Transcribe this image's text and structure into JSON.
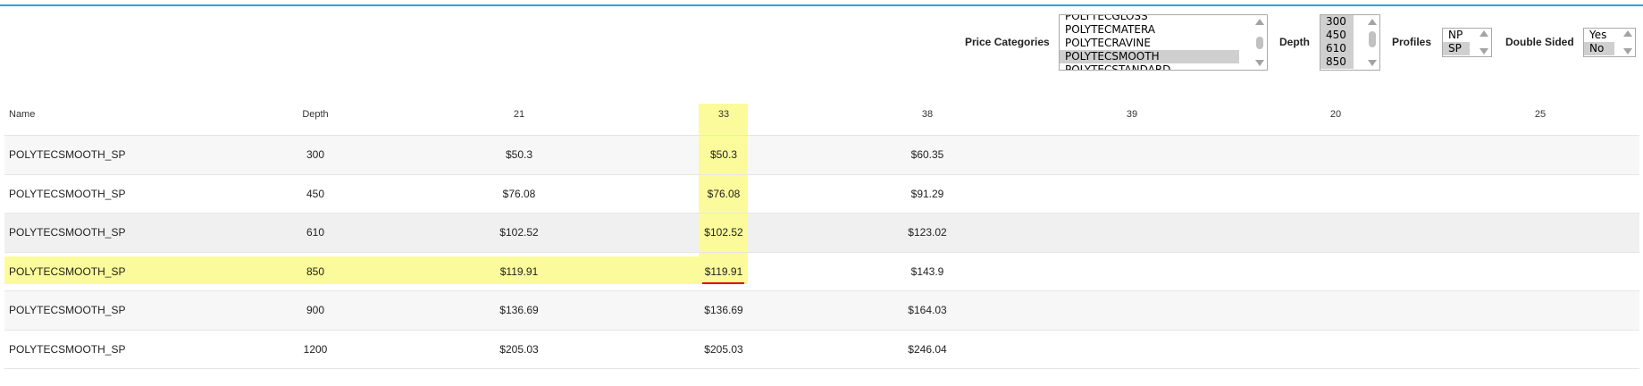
{
  "filters": {
    "price_categories": {
      "label": "Price Categories",
      "options": [
        "POLYTECGLOSS",
        "POLYTECMATERA",
        "POLYTECRAVINE",
        "POLYTECSMOOTH",
        "POLYTECSTANDARD"
      ],
      "selected": "POLYTECSMOOTH"
    },
    "depth": {
      "label": "Depth",
      "options": [
        "300",
        "450",
        "610",
        "850"
      ],
      "selected": [
        "300",
        "450",
        "610",
        "850"
      ]
    },
    "profiles": {
      "label": "Profiles",
      "options": [
        "NP",
        "SP"
      ],
      "selected": "SP"
    },
    "double_sided": {
      "label": "Double Sided",
      "options": [
        "Yes",
        "No"
      ],
      "selected": "No"
    }
  },
  "table": {
    "headers": [
      "Name",
      "Depth",
      "21",
      "33",
      "38",
      "39",
      "20",
      "25"
    ],
    "rows": [
      [
        "POLYTECSMOOTH_SP",
        "300",
        "$50.3",
        "$50.3",
        "$60.35"
      ],
      [
        "POLYTECSMOOTH_SP",
        "450",
        "$76.08",
        "$76.08",
        "$91.29"
      ],
      [
        "POLYTECSMOOTH_SP",
        "610",
        "$102.52",
        "$102.52",
        "$123.02"
      ],
      [
        "POLYTECSMOOTH_SP",
        "850",
        "$119.91",
        "$119.91",
        "$143.9"
      ],
      [
        "POLYTECSMOOTH_SP",
        "900",
        "$136.69",
        "$136.69",
        "$164.03"
      ],
      [
        "POLYTECSMOOTH_SP",
        "1200",
        "$205.03",
        "$205.03",
        "$246.04"
      ]
    ],
    "highlighted_column": "33",
    "highlighted_row_depth": "850"
  },
  "colors": {
    "accent": "#1ea7e1",
    "highlight": "#fbfb9b",
    "underline": "#e00000"
  }
}
